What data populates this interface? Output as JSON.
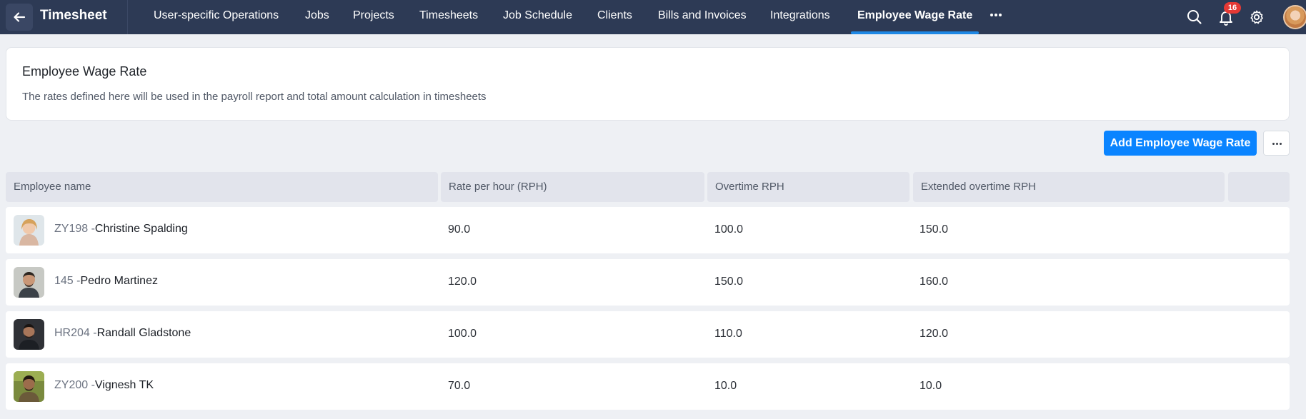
{
  "topbar": {
    "title": "Timesheet",
    "tabs": [
      {
        "label": "User-specific Operations"
      },
      {
        "label": "Jobs"
      },
      {
        "label": "Projects"
      },
      {
        "label": "Timesheets"
      },
      {
        "label": "Job Schedule"
      },
      {
        "label": "Clients"
      },
      {
        "label": "Bills and Invoices"
      },
      {
        "label": "Integrations"
      },
      {
        "label": "Employee Wage Rate",
        "active": true
      }
    ],
    "notifications_count": "16",
    "accent_color": "#1e88e5",
    "background_color": "#2d3a55"
  },
  "info": {
    "title": "Employee Wage Rate",
    "description": "The rates defined here will be used in the payroll report and total amount calculation in timesheets"
  },
  "actions": {
    "add_label": "Add Employee Wage Rate",
    "primary_color": "#0a84ff"
  },
  "table": {
    "headers": [
      "Employee name",
      "Rate per hour (RPH)",
      "Overtime RPH",
      "Extended overtime RPH",
      ""
    ],
    "rows": [
      {
        "code": "ZY198 -",
        "name": "Christine Spalding",
        "rph": "90.0",
        "overtime": "100.0",
        "extended": "150.0"
      },
      {
        "code": "145 -",
        "name": "Pedro Martinez",
        "rph": "120.0",
        "overtime": "150.0",
        "extended": "160.0"
      },
      {
        "code": "HR204 -",
        "name": "Randall Gladstone",
        "rph": "100.0",
        "overtime": "110.0",
        "extended": "120.0"
      },
      {
        "code": "ZY200 -",
        "name": "Vignesh TK",
        "rph": "70.0",
        "overtime": "10.0",
        "extended": "10.0"
      }
    ]
  },
  "icons": [
    "back-arrow-icon",
    "more-horizontal-icon",
    "search-icon",
    "bell-icon",
    "gear-icon",
    "user-avatar"
  ]
}
